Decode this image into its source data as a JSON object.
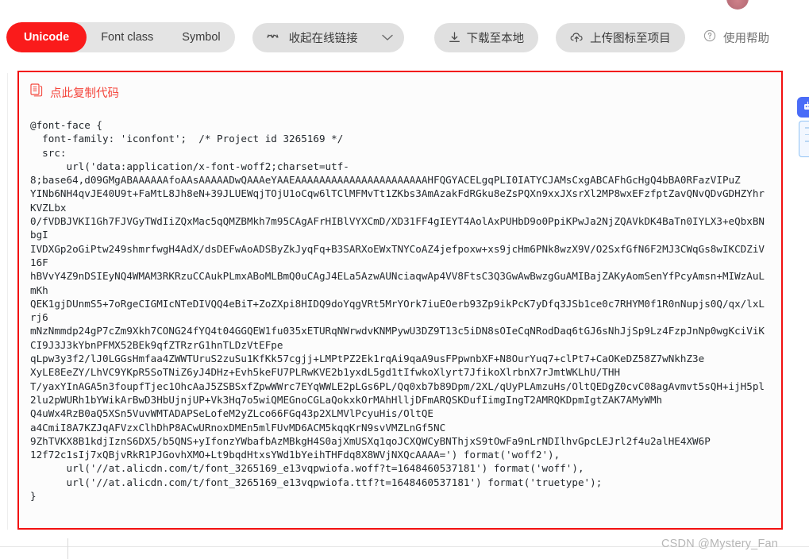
{
  "toolbar": {
    "segments": [
      {
        "label": "Unicode",
        "active": true
      },
      {
        "label": "Font class",
        "active": false
      },
      {
        "label": "Symbol",
        "active": false
      }
    ],
    "collapse_link_button": {
      "label": "收起在线链接",
      "icon": "link-icon",
      "chevron": "chevron-down-icon"
    },
    "download_button": {
      "label": "下载至本地",
      "icon": "download-icon"
    },
    "upload_button": {
      "label": "上传图标至项目",
      "icon": "upload-cloud-icon"
    },
    "help_link": {
      "label": "使用帮助",
      "icon": "question-circle-icon"
    }
  },
  "code_card": {
    "copy_label": "点此复制代码",
    "copy_icon": "copy-document-icon",
    "border_color": "#f21111",
    "code": "@font-face {\n  font-family: 'iconfont';  /* Project id 3265169 */\n  src:\n      url('data:application/x-font-woff2;charset=utf-\n8;base64,d09GMgABAAAAAAfoAAsAAAAADwQAAAeYAAEAAAAAAAAAAAAAAAAAAAAAAHFQGYACELgqPLI0IATYCJAMsCxgABCAFhGcHgQ4bBA0RFazVIPuZ\nYINb6NH4qvJE40U9t+FaMtL8Jh8eN+39JLUEWqjTOjU1oCqw6lTClMFMvTt1ZKbs3AmAzakFdRGku8eZsPQXn9xxJXsrXl2MP8wxEFzfptZavQNvQDvGDHZYhrKVZLbx\n0/fVDBJVKI1Gh7FJVGyTWdIiZQxMac5qQMZBMkh7m95CAgAFrHIBlVYXCmD/XD31FF4gIEYT4AolAxPUHbD9o0PpiKPwJa2NjZQAVkDK4BaTn0IYLX3+eQbxBNbgI\nIVDXGp2oGiPtw249shmrfwgH4AdX/dsDEFwAoADSByZkJyqFq+B3SARXoEWxTNYCoAZ4jefpoxw+xs9jcHm6PNk8wzX9V/O2SxfGfN6F2MJ3CWqGs8wIKCDZiV16F\nhBVvY4Z9nDSIEyNQ4WMAM3RKRzuCCAukPLmxABoMLBmQ0uCAgJ4ELa5AzwAUNciaqwAp4VV8FtsC3Q3GwAwBwzgGuAMIBajZAKyAomSenYfPcyAmsn+MIWzAuLmKh\nQEK1gjDUnmS5+7oRgeCIGMIcNTeDIVQQ4eBiT+ZoZXpi8HIDQ9doYqgVRt5MrYOrk7iuEOerb93Zp9ikPcK7yDfq3JSb1ce0c7RHYM0f1R0nNupjs0Q/qx/lxLrj6\nmNzNmmdp24gP7cZm9Xkh7CONG24fYQ4t04GGQEW1fu035xETURqNWrwdvKNMPywU3DZ9T13c5iDN8sOIeCqNRodDaq6tGJ6sNhJjSp9Lz4FzpJnNp0wgKciViKCI9J3J3kYbnPFMX52BEk9qfZTRzrG1hnTLDzVtEFpe\nqLpw3y3f2/lJ0LGGsHmfaa4ZWWTUruS2zuSu1KfKk57cgjj+LMPtPZ2Ek1rqAi9qaA9usFPpwnbXF+N8OurYuq7+clPt7+CaOKeDZ58Z7wNkhZ3e\nXyLE8EeZY/LhVC9YKpR5SoTNiZ6yJ4DHz+Evh5keFU7PLRwKVE2b1yxdL5gd1tIfwkoXlyrt7JfikoXlrbnX7rJmtWKLhU/THH\nT/yaxYInAGA5n3foupfTjec1OhcAaJ5ZSBSxfZpwWWrc7EYqWWLE2pLGs6PL/Qq0xb7b89Dpm/2XL/qUyPLAmzuHs/OltQEDgZ0cvC08agAvmvt5sQH+ijH5pl2lu2pWURh1bYWikArBwD3HbUjnjUP+Vk3Hq7o5wiQMEGnoCGLaQokxkOrMAhHlljDFmARQSKDufIimgIngT2AMRQKDpmIgtZAK7AMyWMh\nQ4uWx4RzB0aQ5XSn5VuvWMTADAPSeLofeM2yZLco66FGq43p2XLMVlPcyuHis/OltQE\na4CmiI8A7KZJqAFVzxClhDhP8ACwURnoxDMEn5mlFUvMD6ACM5kqqKrN9svVMZLnGf5NC\n9ZhTVKX8B1kdjIznS6DX5/b5QNS+yIfonzYWbafbAzMBkgH4S0ajXmUSXq1qoJCXQWCyBNThjxS9tOwFa9nLrNDIlhvGpcLEJrl2f4u2alHE4XW6P\n12f72c1sIj7xQBjvRkR1PJGovhXMO+Lt9bqdHtxsYWd1bYeihTHFdq8X8WVjNXQcAAAA=') format('woff2'),\n      url('//at.alicdn.com/t/font_3265169_e13vqpwiofa.woff?t=1648460537181') format('woff'),\n      url('//at.alicdn.com/t/font_3265169_e13vqpwiofa.ttf?t=1648460537181') format('truetype');\n}"
  },
  "float_widgets": {
    "top_button_icon": "robot-icon",
    "panel_icon": "list-panel-icon"
  },
  "footer": {
    "watermark": "CSDN @Mystery_Fan"
  }
}
